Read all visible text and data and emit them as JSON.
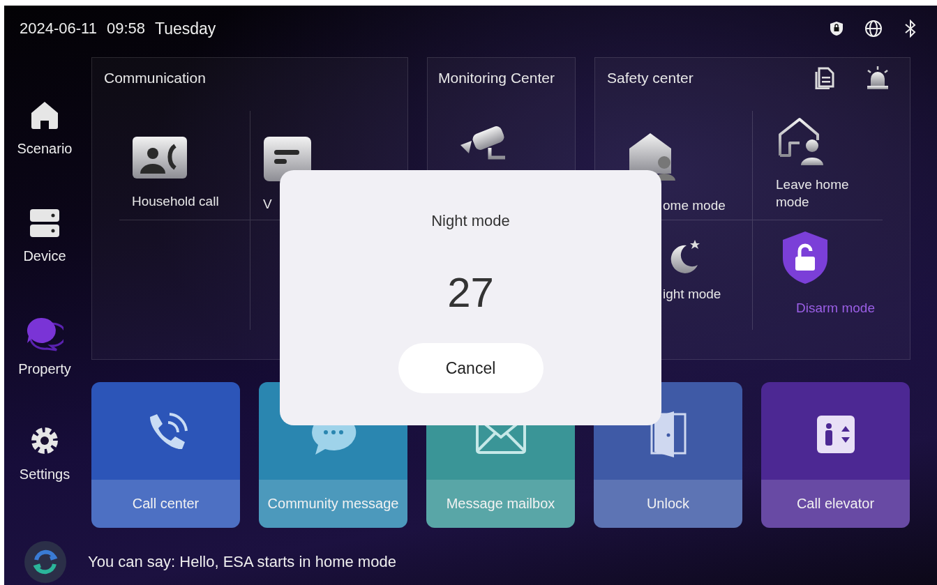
{
  "status_bar": {
    "date": "2024-06-11",
    "time": "09:58",
    "weekday": "Tuesday"
  },
  "sidebar": {
    "items": [
      {
        "label": "Scenario"
      },
      {
        "label": "Device"
      },
      {
        "label": "Property"
      },
      {
        "label": "Settings"
      }
    ]
  },
  "communication": {
    "title": "Communication",
    "items": [
      {
        "label": "Household call"
      },
      {
        "label": "V"
      }
    ]
  },
  "monitoring": {
    "title": "Monitoring Center"
  },
  "safety": {
    "title": "Safety center",
    "modes": [
      {
        "label": "ome mode",
        "selected": false
      },
      {
        "label": "Leave home mode",
        "selected": false
      },
      {
        "label": "ight mode",
        "selected": false
      },
      {
        "label": "Disarm mode",
        "selected": true
      }
    ]
  },
  "tiles": [
    {
      "label": "Call center",
      "color": "#2c55b8"
    },
    {
      "label": "Community message",
      "color": "#2a86b0"
    },
    {
      "label": "Message mailbox",
      "color": "#3a9597"
    },
    {
      "label": "Unlock",
      "color": "#3f5aa6"
    },
    {
      "label": "Call elevator",
      "color": "#4c2893"
    }
  ],
  "dialog": {
    "title": "Night mode",
    "countdown": "27",
    "cancel": "Cancel"
  },
  "voice": {
    "hint": "You can say: Hello, ESA starts in home mode"
  }
}
